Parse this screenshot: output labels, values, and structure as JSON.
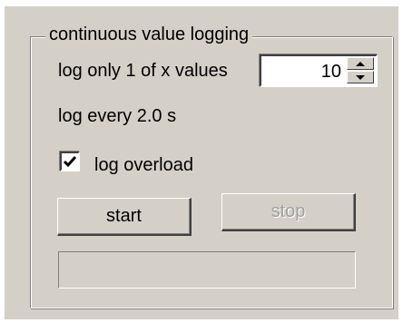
{
  "group": {
    "title": "continuous value logging"
  },
  "fields": {
    "log_only_label": "log only 1 of x values",
    "log_only_value": "10",
    "log_every_text": "log every 2.0 s"
  },
  "checkbox": {
    "label": "log overload",
    "checked": true
  },
  "buttons": {
    "start": "start",
    "stop": "stop",
    "stop_enabled": false
  },
  "progress": {
    "value": 0
  },
  "icons": {
    "spin_up": "arrow-up-icon",
    "spin_down": "arrow-down-icon",
    "check": "checkmark-icon"
  },
  "colors": {
    "face": "#d4d0c8",
    "disabled_text": "#a0a0a0"
  }
}
